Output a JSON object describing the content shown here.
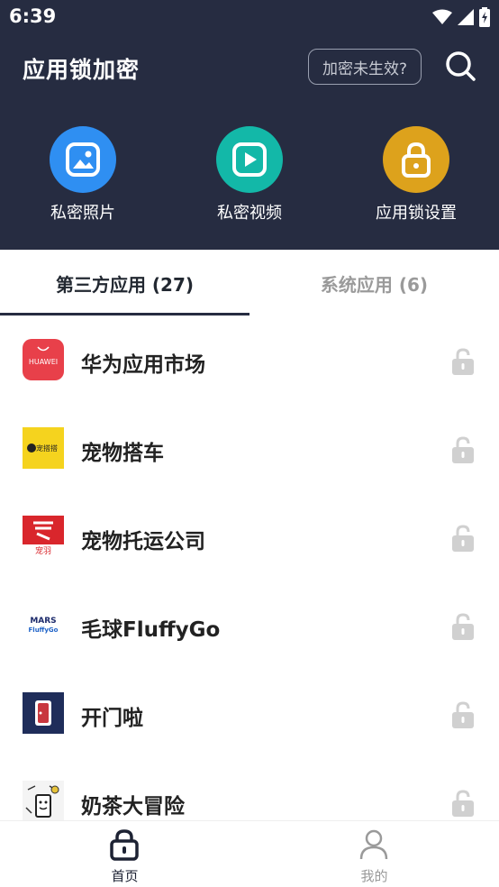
{
  "status_bar": {
    "time": "6:39"
  },
  "header": {
    "title": "应用锁加密",
    "hint_button": "加密未生效?"
  },
  "features": [
    {
      "label": "私密照片",
      "icon": "photo-icon",
      "color": "#2f8ff2"
    },
    {
      "label": "私密视频",
      "icon": "video-icon",
      "color": "#13b8a8"
    },
    {
      "label": "应用锁设置",
      "icon": "lock-icon",
      "color": "#dda21c"
    }
  ],
  "tabs": [
    {
      "label": "第三方应用 (27)",
      "active": true
    },
    {
      "label": "系统应用 (6)",
      "active": false
    }
  ],
  "apps": [
    {
      "name": "华为应用市场",
      "icon_text": "HUAWEI",
      "locked": false
    },
    {
      "name": "宠物搭车",
      "icon_text": "宠搭搭",
      "locked": false
    },
    {
      "name": "宠物托运公司",
      "icon_text": "宠羽",
      "locked": false
    },
    {
      "name": "毛球FluffyGo",
      "icon_text": "MARS FluffyGo",
      "locked": false
    },
    {
      "name": "开门啦",
      "icon_text": "",
      "locked": false
    },
    {
      "name": "奶茶大冒险",
      "icon_text": "",
      "locked": false
    }
  ],
  "bottom_nav": [
    {
      "label": "首页",
      "icon": "lock-icon",
      "active": true
    },
    {
      "label": "我的",
      "icon": "user-icon",
      "active": false
    }
  ],
  "colors": {
    "header_bg": "#262c41",
    "active_text": "#222831",
    "inactive_text": "#9a9a9a"
  }
}
